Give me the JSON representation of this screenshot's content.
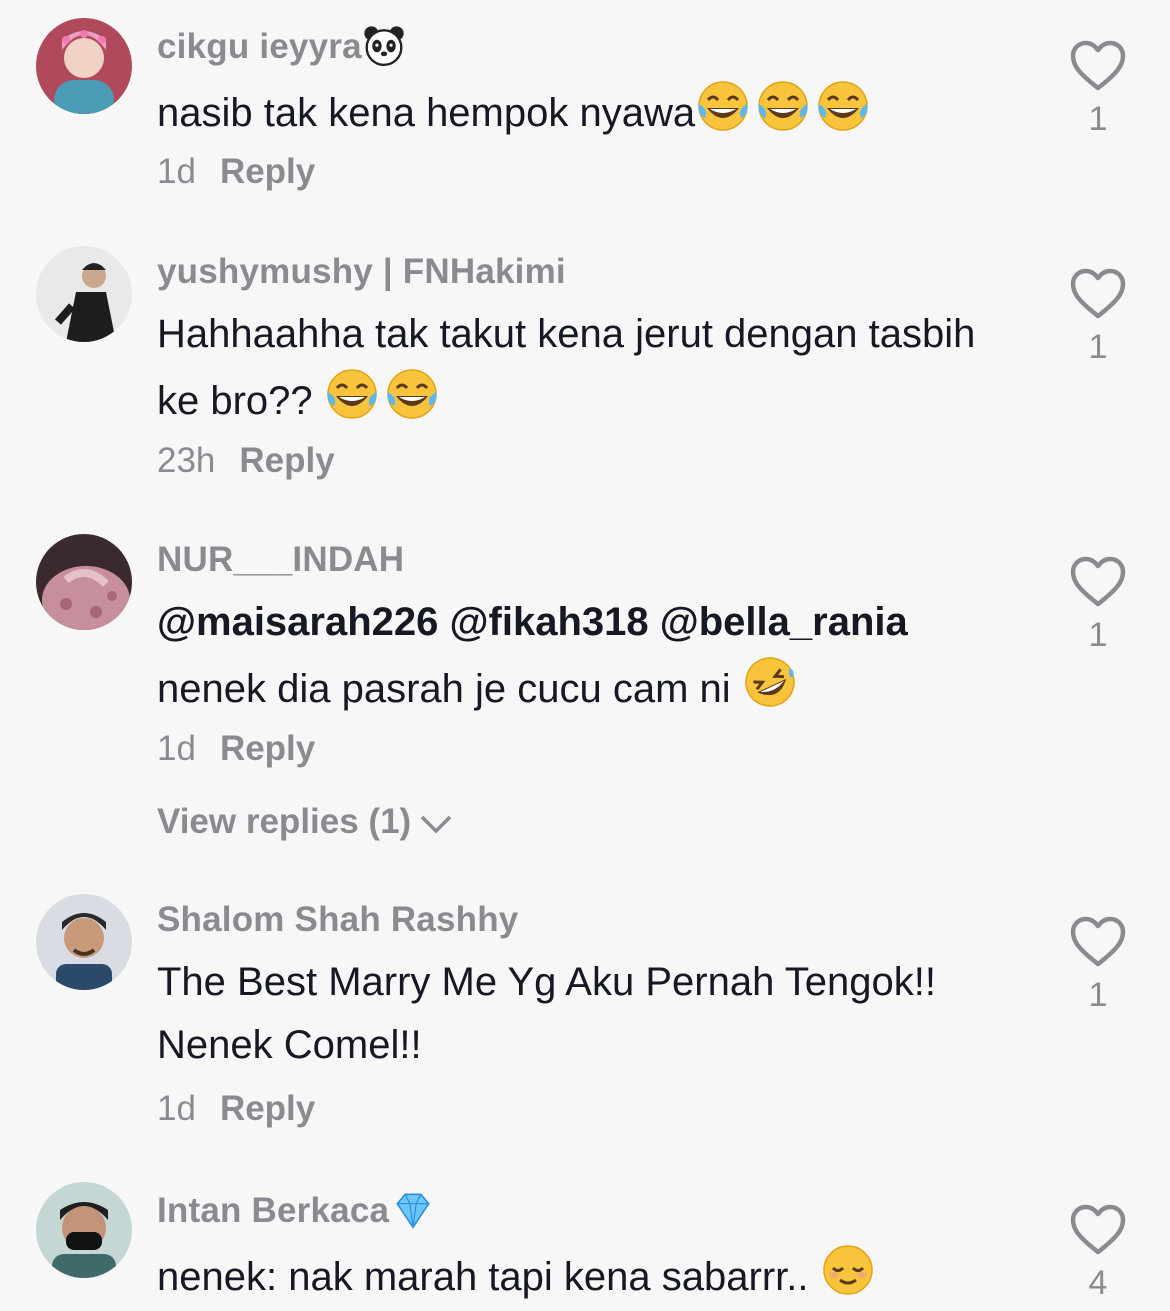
{
  "comments": [
    {
      "username": "cikgu ieyyra",
      "username_emoji": "panda",
      "text": "nasib tak kena hempok nyawa",
      "text_emojis": [
        "joy",
        "joy",
        "joy"
      ],
      "time": "1d",
      "reply": "Reply",
      "likes": "1"
    },
    {
      "username": "yushymushy | FNHakimi",
      "text": "Hahhaahha tak takut kena jerut dengan tasbih ke bro??",
      "text_emojis": [
        "joy",
        "joy"
      ],
      "time": "23h",
      "reply": "Reply",
      "likes": "1"
    },
    {
      "username": "NUR___INDAH",
      "mentions": "@maisarah226 @fikah318 @bella_rania",
      "text": "nenek dia pasrah je cucu cam ni",
      "text_emojis": [
        "rofl"
      ],
      "time": "1d",
      "reply": "Reply",
      "likes": "1",
      "view_replies": "View replies (1)"
    },
    {
      "username": "Shalom Shah Rashhy",
      "text": "The Best Marry Me Yg Aku Pernah Tengok!! Nenek Comel!!",
      "time": "1d",
      "reply": "Reply",
      "likes": "1"
    },
    {
      "username": "Intan Berkaca",
      "username_emoji": "gem",
      "text": "nenek: nak marah tapi kena sabarrr..",
      "text_emojis": [
        "relieved"
      ],
      "likes": "4"
    }
  ],
  "icons": {
    "like": "heart-outline-icon",
    "expand": "chevron-down-icon"
  },
  "colors": {
    "background": "#f7f7f7",
    "primary_text": "#161823",
    "secondary_text": "#8a8b91"
  }
}
